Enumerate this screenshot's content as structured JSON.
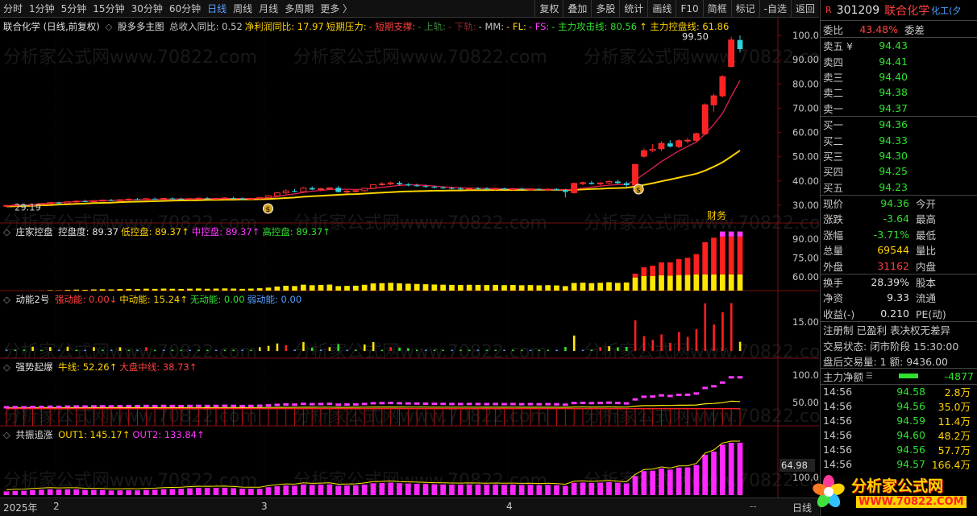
{
  "toolbar": {
    "left": [
      "分时",
      "1分钟",
      "5分钟",
      "15分钟",
      "30分钟",
      "60分钟",
      "日线",
      "周线",
      "月线",
      "多周期",
      "更多 〉"
    ],
    "active": "日线",
    "right": [
      "复权",
      "叠加",
      "多股",
      "统计",
      "画线",
      "F10",
      "简框",
      "标记",
      "-自选",
      "返回"
    ]
  },
  "main_panel": {
    "title": "联合化学 (日线,前复权)",
    "indicator": "股多多主图",
    "items": [
      {
        "text": "总收入同比: 0.52",
        "color": "#c8c8c8"
      },
      {
        "text": "净利润同比: 17.97",
        "color": "#ffd200"
      },
      {
        "text": "短期压力:",
        "color": "#ffd200"
      },
      {
        "text": "- 短期支撑:",
        "color": "#ff4040"
      },
      {
        "text": "- 上轨:",
        "color": "#3a8a3a"
      },
      {
        "text": "- 下轨:",
        "color": "#8a2a2a"
      },
      {
        "text": "- MM:",
        "color": "#c8c8c8"
      },
      {
        "text": "- FL:",
        "color": "#ffd200"
      },
      {
        "text": "- FS:",
        "color": "#ff38ff"
      },
      {
        "text": "- 主力攻击线: 80.56",
        "color": "#2fe02f"
      },
      {
        "text": "↑ 主力控盘线: 61.86",
        "color": "#ffd200"
      }
    ],
    "y_ticks": [
      "100.00",
      "90.00",
      "80.00",
      "70.00",
      "60.00",
      "50.00",
      "40.00",
      "30.00"
    ],
    "high_label": "99.50",
    "low_label": "29.19",
    "badge": "财务"
  },
  "panel2": {
    "name": "庄家控盘",
    "items": [
      {
        "text": "控盘度: 89.37",
        "color": "#e0e0e0"
      },
      {
        "text": "低控盘: 89.37↑",
        "color": "#ffd200"
      },
      {
        "text": "中控盘: 89.37↑",
        "color": "#ff38ff"
      },
      {
        "text": "高控盘: 89.37↑",
        "color": "#2fe02f"
      }
    ],
    "y_ticks": [
      "90.00",
      "75.00",
      "60.00"
    ]
  },
  "panel3": {
    "name": "动能2号",
    "items": [
      {
        "text": "强动能: 0.00↓",
        "color": "#ff4040"
      },
      {
        "text": "中动能: 15.24↑",
        "color": "#ffd200"
      },
      {
        "text": "无动能: 0.00",
        "color": "#2fe02f"
      },
      {
        "text": "弱动能: 0.00",
        "color": "#50a0ff"
      }
    ],
    "y_ticks": [
      "15.00"
    ]
  },
  "panel4": {
    "name": "强势起爆",
    "items": [
      {
        "text": "牛线: 52.26↑",
        "color": "#ffd200"
      },
      {
        "text": "大盘中线: 38.73↑",
        "color": "#ff4040"
      }
    ],
    "y_ticks": [
      "100.00",
      "50.00"
    ]
  },
  "panel5": {
    "name": "共振追涨",
    "items": [
      {
        "text": "OUT1: 145.17↑",
        "color": "#ffd200"
      },
      {
        "text": "OUT2: 133.84↑",
        "color": "#ff38ff"
      }
    ],
    "y_ticks": [
      "100.00"
    ],
    "last_label": "64.98"
  },
  "bottom_axis": {
    "labels": [
      "2025年",
      "2",
      "3",
      "4"
    ],
    "scroll": "--",
    "right_tab": "日线"
  },
  "quote": {
    "code": "301209",
    "name": "联合化学",
    "tag": "化工(夕",
    "weibi_label": "委比",
    "weibi_value": "43.48%",
    "weicha_label": "委差",
    "asks": [
      {
        "label": "卖五 ¥",
        "price": "94.43"
      },
      {
        "label": "卖四",
        "price": "94.41"
      },
      {
        "label": "卖三",
        "price": "94.40"
      },
      {
        "label": "卖二",
        "price": "94.38"
      },
      {
        "label": "卖一",
        "price": "94.37"
      }
    ],
    "bids": [
      {
        "label": "买一",
        "price": "94.36"
      },
      {
        "label": "买二",
        "price": "94.33"
      },
      {
        "label": "买三",
        "price": "94.30"
      },
      {
        "label": "买四",
        "price": "94.25"
      },
      {
        "label": "买五",
        "price": "94.23"
      }
    ],
    "stats": [
      {
        "l": "现价",
        "v": "94.36",
        "vc": "grn",
        "r": "今开"
      },
      {
        "l": "涨跌",
        "v": "-3.64",
        "vc": "grn",
        "r": "最高"
      },
      {
        "l": "涨幅",
        "v": "-3.71%",
        "vc": "grn",
        "r": "最低"
      },
      {
        "l": "总量",
        "v": "69544",
        "vc": "yel",
        "r": "量比"
      },
      {
        "l": "外盘",
        "v": "31162",
        "vc": "red",
        "r": "内盘"
      }
    ],
    "stats2": [
      {
        "l": "换手",
        "v": "28.39%",
        "vc": "wht",
        "r": "股本"
      },
      {
        "l": "净资",
        "v": "9.33",
        "vc": "wht",
        "r": "流通"
      },
      {
        "l": "收益(-)",
        "v": "0.210",
        "vc": "wht",
        "r": "PE(动)"
      }
    ],
    "reg": "注册制 已盈利 表决权无差异",
    "trade_state": "交易状态: 闭市阶段 15:30:00",
    "after_hours": "盘后交易量: 1  额: 9436.00",
    "main_flow_label": "主力净额",
    "main_flow_value": "-4877",
    "ticks": [
      {
        "t": "14:56",
        "p": "94.58",
        "a": "2.8万",
        "ac": "yel"
      },
      {
        "t": "14:56",
        "p": "94.56",
        "a": "35.0万",
        "ac": "yel"
      },
      {
        "t": "14:56",
        "p": "94.59",
        "a": "11.4万",
        "ac": "yel"
      },
      {
        "t": "14:56",
        "p": "94.60",
        "a": "48.2万",
        "ac": "yel"
      },
      {
        "t": "14:56",
        "p": "94.56",
        "a": "57.7万",
        "ac": "yel"
      },
      {
        "t": "14:56",
        "p": "94.57",
        "a": "166.4万",
        "ac": "yel"
      }
    ]
  },
  "watermark": "分析家公式网www.70822.com",
  "logo": {
    "text": "分析家公式网",
    "url": "WWW.70822.COM"
  },
  "chart_data": {
    "type": "candlestick",
    "title": "联合化学 (日线,前复权)",
    "ylim": [
      25,
      105
    ],
    "candles": [
      [
        29.6,
        30.2,
        29.2,
        29.9
      ],
      [
        29.9,
        30.4,
        29.5,
        30.1
      ],
      [
        30.1,
        30.5,
        29.7,
        29.9
      ],
      [
        29.9,
        30.6,
        29.7,
        30.4
      ],
      [
        30.4,
        31.0,
        30.1,
        30.7
      ],
      [
        30.7,
        31.3,
        30.3,
        31.1
      ],
      [
        31.1,
        31.5,
        30.6,
        30.9
      ],
      [
        30.9,
        31.6,
        30.7,
        31.4
      ],
      [
        31.4,
        32.0,
        31.0,
        31.7
      ],
      [
        31.7,
        32.3,
        31.2,
        31.5
      ],
      [
        31.5,
        32.2,
        31.2,
        31.9
      ],
      [
        31.9,
        32.4,
        31.5,
        32.1
      ],
      [
        32.1,
        32.6,
        31.7,
        31.9
      ],
      [
        31.9,
        32.5,
        31.6,
        32.3
      ],
      [
        32.3,
        32.8,
        31.9,
        32.5
      ],
      [
        32.5,
        33.0,
        32.1,
        32.3
      ],
      [
        32.3,
        32.9,
        32.0,
        32.7
      ],
      [
        32.7,
        33.1,
        32.3,
        32.5
      ],
      [
        32.5,
        33.0,
        32.2,
        32.8
      ],
      [
        32.8,
        33.3,
        32.4,
        32.6
      ],
      [
        32.6,
        33.1,
        32.2,
        32.4
      ],
      [
        32.4,
        32.9,
        32.0,
        32.7
      ],
      [
        32.7,
        33.2,
        32.3,
        32.9
      ],
      [
        32.9,
        33.4,
        32.5,
        32.6
      ],
      [
        32.6,
        33.1,
        32.2,
        32.8
      ],
      [
        32.8,
        33.3,
        32.4,
        33.0
      ],
      [
        33.0,
        33.5,
        32.6,
        32.8
      ],
      [
        32.8,
        33.2,
        32.3,
        32.5
      ],
      [
        32.5,
        33.0,
        32.1,
        32.8
      ],
      [
        32.8,
        33.4,
        32.4,
        33.2
      ],
      [
        33.2,
        34.2,
        32.8,
        33.9
      ],
      [
        33.9,
        35.6,
        33.5,
        35.1
      ],
      [
        35.1,
        36.5,
        34.6,
        35.9
      ],
      [
        35.9,
        36.7,
        35.3,
        35.6
      ],
      [
        35.6,
        37.5,
        35.3,
        37.1
      ],
      [
        37.1,
        37.8,
        36.2,
        36.5
      ],
      [
        36.5,
        37.2,
        35.8,
        36.8
      ],
      [
        36.8,
        37.5,
        36.2,
        37.2
      ],
      [
        37.2,
        37.9,
        35.2,
        35.5
      ],
      [
        35.5,
        36.3,
        34.8,
        35.8
      ],
      [
        35.8,
        36.4,
        35.2,
        36.0
      ],
      [
        36.0,
        37.3,
        35.6,
        37.0
      ],
      [
        37.0,
        38.8,
        36.6,
        38.5
      ],
      [
        38.5,
        39.5,
        38.0,
        38.8
      ],
      [
        38.8,
        39.8,
        38.3,
        39.2
      ],
      [
        39.2,
        39.9,
        38.2,
        38.6
      ],
      [
        38.6,
        39.2,
        37.8,
        38.2
      ],
      [
        38.2,
        38.9,
        37.6,
        37.9
      ],
      [
        37.9,
        38.5,
        37.2,
        37.6
      ],
      [
        37.6,
        38.1,
        36.9,
        37.3
      ],
      [
        37.3,
        37.9,
        36.8,
        37.1
      ],
      [
        37.1,
        37.6,
        36.6,
        36.9
      ],
      [
        36.9,
        37.4,
        36.4,
        36.8
      ],
      [
        36.8,
        37.3,
        36.3,
        37.0
      ],
      [
        37.0,
        37.5,
        36.5,
        36.9
      ],
      [
        36.9,
        37.4,
        36.4,
        36.7
      ],
      [
        36.7,
        37.2,
        36.2,
        36.9
      ],
      [
        36.9,
        37.3,
        36.4,
        36.6
      ],
      [
        36.6,
        37.1,
        36.1,
        36.8
      ],
      [
        36.8,
        37.2,
        36.3,
        36.5
      ],
      [
        36.5,
        37.0,
        36.0,
        36.7
      ],
      [
        36.7,
        37.1,
        36.2,
        36.4
      ],
      [
        36.4,
        36.9,
        35.9,
        36.6
      ],
      [
        36.6,
        37.0,
        36.1,
        36.3
      ],
      [
        36.3,
        36.8,
        33.2,
        35.5
      ],
      [
        35.2,
        39.3,
        34.8,
        39.0
      ],
      [
        39.0,
        39.8,
        38.2,
        39.3
      ],
      [
        39.3,
        40.0,
        38.5,
        38.8
      ],
      [
        38.8,
        39.5,
        38.2,
        39.2
      ],
      [
        39.2,
        40.2,
        38.7,
        39.8
      ],
      [
        39.8,
        40.5,
        38.8,
        39.1
      ],
      [
        39.1,
        39.8,
        37.5,
        38.3
      ],
      [
        38.3,
        47.0,
        37.8,
        46.8
      ],
      [
        50.2,
        53.4,
        49.6,
        52.5
      ],
      [
        52.5,
        55.2,
        51.8,
        53.0
      ],
      [
        53.3,
        56.4,
        52.4,
        55.5
      ],
      [
        55.5,
        56.8,
        53.8,
        54.2
      ],
      [
        54.2,
        57.2,
        53.6,
        56.6
      ],
      [
        56.6,
        57.8,
        55.5,
        56.8
      ],
      [
        56.8,
        60.0,
        56.2,
        59.5
      ],
      [
        59.5,
        72.0,
        59.0,
        71.4
      ],
      [
        71.4,
        75.8,
        68.6,
        75.1
      ],
      [
        75.1,
        83.6,
        74.5,
        83.0
      ],
      [
        87.2,
        99.5,
        86.8,
        98.1
      ],
      [
        98.1,
        100.0,
        93.0,
        94.36
      ]
    ],
    "ma_short": [
      29.8,
      30.0,
      30.1,
      30.3,
      30.6,
      30.9,
      31.1,
      31.3,
      31.5,
      31.7,
      31.8,
      31.9,
      32.0,
      32.1,
      32.2,
      32.3,
      32.4,
      32.5,
      32.5,
      32.6,
      32.6,
      32.6,
      32.7,
      32.7,
      32.7,
      32.8,
      32.8,
      32.8,
      32.8,
      32.9,
      33.1,
      33.6,
      34.2,
      34.7,
      35.3,
      35.8,
      36.1,
      36.5,
      36.6,
      36.6,
      36.5,
      36.6,
      37.0,
      37.4,
      37.8,
      38.2,
      38.4,
      38.4,
      38.2,
      37.9,
      37.6,
      37.4,
      37.2,
      37.1,
      37.0,
      36.9,
      36.9,
      36.8,
      36.8,
      36.7,
      36.7,
      36.6,
      36.6,
      36.5,
      36.3,
      36.6,
      37.1,
      37.5,
      37.9,
      38.3,
      38.5,
      38.6,
      40.3,
      42.9,
      45.4,
      48.0,
      50.2,
      52.4,
      54.3,
      56.0,
      59.4,
      63.3,
      67.9,
      74.9,
      81.5
    ],
    "ma_long": [
      29.5,
      29.6,
      29.7,
      29.8,
      30.0,
      30.1,
      30.3,
      30.4,
      30.6,
      30.7,
      30.9,
      31.0,
      31.1,
      31.3,
      31.4,
      31.5,
      31.6,
      31.7,
      31.8,
      31.9,
      32.0,
      32.0,
      32.1,
      32.2,
      32.2,
      32.3,
      32.3,
      32.4,
      32.4,
      32.5,
      32.6,
      32.8,
      33.0,
      33.2,
      33.5,
      33.7,
      33.9,
      34.1,
      34.3,
      34.5,
      34.6,
      34.8,
      35.0,
      35.2,
      35.4,
      35.6,
      35.7,
      35.8,
      35.9,
      36.0,
      36.0,
      36.1,
      36.1,
      36.2,
      36.2,
      36.2,
      36.3,
      36.3,
      36.3,
      36.3,
      36.4,
      36.4,
      36.4,
      36.4,
      36.3,
      36.4,
      36.5,
      36.7,
      36.8,
      37.0,
      37.1,
      37.2,
      37.7,
      38.4,
      39.1,
      39.9,
      40.6,
      41.4,
      42.2,
      43.0,
      44.3,
      45.9,
      47.7,
      50.1,
      52.6
    ]
  }
}
